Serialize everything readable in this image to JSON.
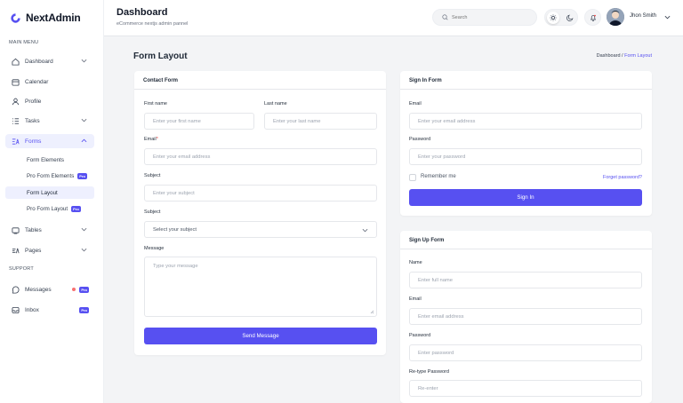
{
  "brand": {
    "name": "NextAdmin"
  },
  "sidebar": {
    "menu_title": "MAIN MENU",
    "support_title": "SUPPORT",
    "items": [
      {
        "label": "Dashboard"
      },
      {
        "label": "Calendar"
      },
      {
        "label": "Profile"
      },
      {
        "label": "Tasks"
      },
      {
        "label": "Forms"
      },
      {
        "label": "Tables"
      },
      {
        "label": "Pages"
      }
    ],
    "forms_sub": [
      {
        "label": "Form Elements"
      },
      {
        "label": "Pro Form Elements",
        "badge": "Pro"
      },
      {
        "label": "Form Layout"
      },
      {
        "label": "Pro Form Layout",
        "badge": "Pro"
      }
    ],
    "support_items": [
      {
        "label": "Messages",
        "badge": "Pro"
      },
      {
        "label": "Inbox",
        "badge": "Pro"
      }
    ]
  },
  "header": {
    "title": "Dashboard",
    "subtitle": "eCommerce nextjs admin pannel",
    "search_placeholder": "Search",
    "user_name": "Jhon Smith"
  },
  "page": {
    "title": "Form Layout",
    "breadcrumb_root": "Dashboard /",
    "breadcrumb_current": "Form Layout"
  },
  "contact_form": {
    "title": "Contact Form",
    "first_name_label": "First name",
    "first_name_placeholder": "Enter your first name",
    "last_name_label": "Last name",
    "last_name_placeholder": "Enter your last name",
    "email_label": "Email",
    "email_placeholder": "Enter your email address",
    "subject_label": "Subject",
    "subject_placeholder": "Enter your subject",
    "subject_select_label": "Subject",
    "subject_select_value": "Select your subject",
    "message_label": "Message",
    "message_placeholder": "Type your message",
    "submit_label": "Send Message"
  },
  "signin_form": {
    "title": "Sign In Form",
    "email_label": "Email",
    "email_placeholder": "Enter your email address",
    "password_label": "Password",
    "password_placeholder": "Enter your password",
    "remember_label": "Remember me",
    "forgot_label": "Forget password?",
    "submit_label": "Sign In"
  },
  "signup_form": {
    "title": "Sign Up Form",
    "name_label": "Name",
    "name_placeholder": "Enter full name",
    "email_label": "Email",
    "email_placeholder": "Enter email address",
    "password_label": "Password",
    "password_placeholder": "Enter password",
    "retype_label": "Re-type Password",
    "retype_placeholder": "Re-enter"
  },
  "colors": {
    "accent": "#5750f1",
    "accent_light": "#eef0fe",
    "background": "#f3f4f6"
  }
}
